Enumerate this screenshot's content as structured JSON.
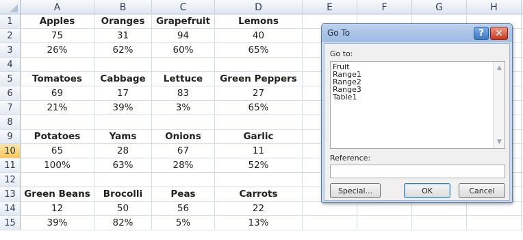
{
  "columns": [
    "A",
    "B",
    "C",
    "D",
    "E",
    "F",
    "G",
    "H"
  ],
  "row_numbers": [
    "1",
    "2",
    "3",
    "4",
    "5",
    "6",
    "7",
    "8",
    "9",
    "10",
    "11",
    "12",
    "13",
    "14",
    "15"
  ],
  "selected_row": "10",
  "rows": [
    [
      "Apples",
      "Oranges",
      "Grapefruit",
      "Lemons"
    ],
    [
      "75",
      "31",
      "94",
      "40"
    ],
    [
      "26%",
      "62%",
      "60%",
      "65%"
    ],
    [
      "",
      "",
      "",
      ""
    ],
    [
      "Tomatoes",
      "Cabbage",
      "Lettuce",
      "Green Peppers"
    ],
    [
      "69",
      "17",
      "83",
      "27"
    ],
    [
      "21%",
      "39%",
      "3%",
      "65%"
    ],
    [
      "",
      "",
      "",
      ""
    ],
    [
      "Potatoes",
      "Yams",
      "Onions",
      "Garlic"
    ],
    [
      "65",
      "28",
      "67",
      "11"
    ],
    [
      "100%",
      "63%",
      "28%",
      "52%"
    ],
    [
      "",
      "",
      "",
      ""
    ],
    [
      "Green Beans",
      "Brocolli",
      "Peas",
      "Carrots"
    ],
    [
      "12",
      "50",
      "56",
      "22"
    ],
    [
      "39%",
      "82%",
      "5%",
      "13%"
    ]
  ],
  "bold_rows": [
    0,
    4,
    8,
    12
  ],
  "dialog": {
    "title": "Go To",
    "help_label": "?",
    "close_label": "✕",
    "goto_label": "Go to:",
    "items": [
      "Fruit",
      "Range1",
      "Range2",
      "Range3",
      "Table1"
    ],
    "reference_label": "Reference:",
    "reference_value": "",
    "special_button": "Special...",
    "ok_button": "OK",
    "cancel_button": "Cancel"
  },
  "colors": {
    "header_blue": "#dfe6ef",
    "selected_row_header": "#f7c65b",
    "dialog_frame": "#c9d9ee",
    "close_red": "#c7361d"
  }
}
